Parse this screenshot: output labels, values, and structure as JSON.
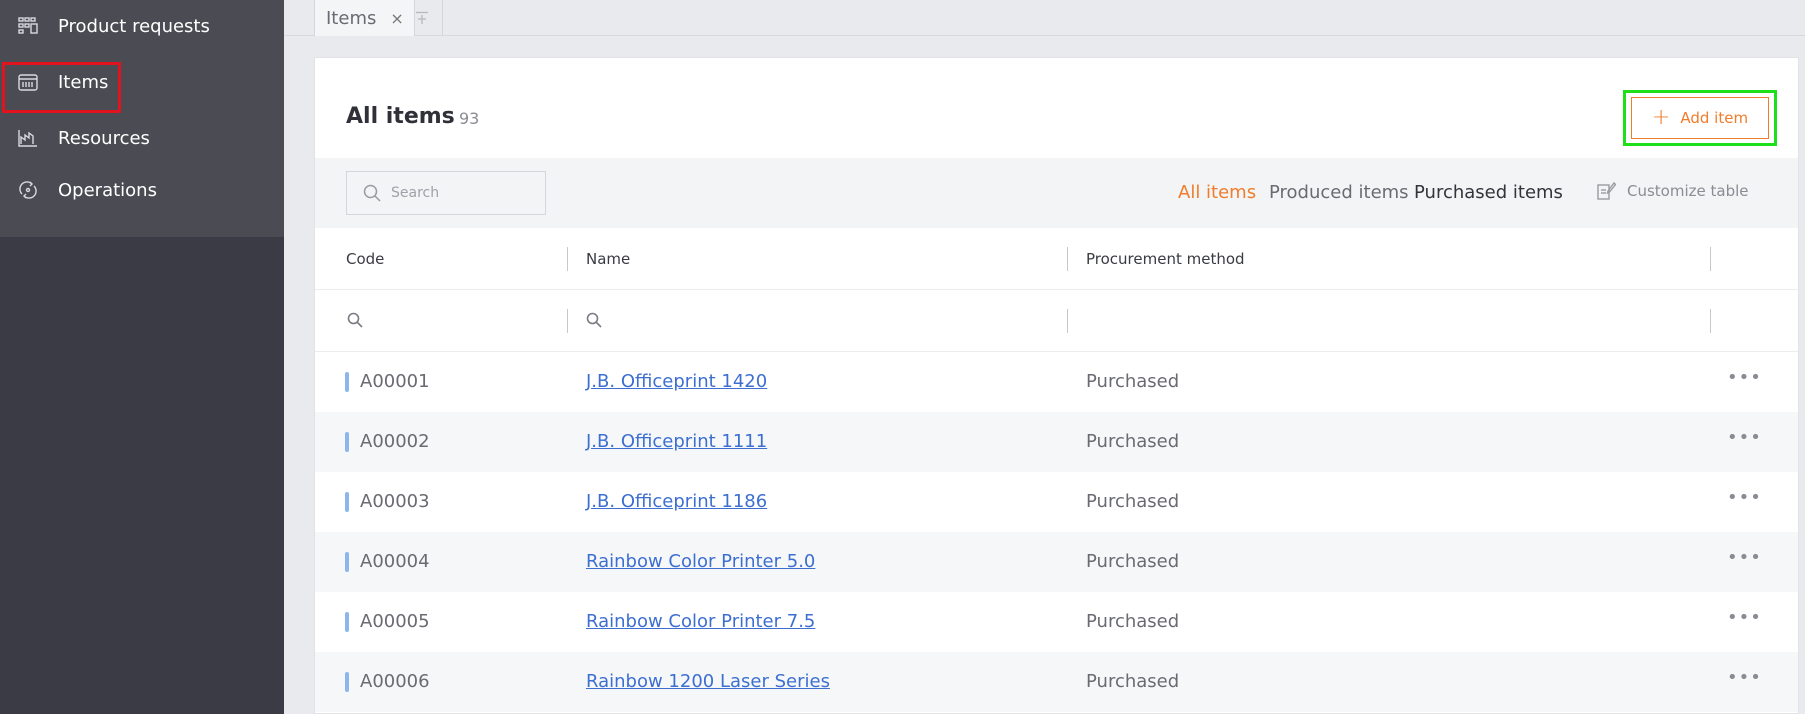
{
  "sidebar": {
    "items": [
      {
        "label": "Product requests",
        "icon": "product-requests-icon"
      },
      {
        "label": "Items",
        "icon": "items-icon"
      },
      {
        "label": "Resources",
        "icon": "resources-icon"
      },
      {
        "label": "Operations",
        "icon": "operations-icon"
      }
    ]
  },
  "tabs": {
    "active_label": "Items",
    "close_glyph": "×"
  },
  "header": {
    "title": "All items",
    "count": "93",
    "add_label": "Add item"
  },
  "toolbar": {
    "search_placeholder": "Search",
    "filters": {
      "all": "All items",
      "produced": "Produced items",
      "purchased": "Purchased items"
    },
    "customize_label": "Customize table"
  },
  "table": {
    "columns": {
      "code": "Code",
      "name": "Name",
      "procurement": "Procurement method"
    },
    "rows": [
      {
        "code": "A00001",
        "name": "J.B. Officeprint 1420",
        "method": "Purchased"
      },
      {
        "code": "A00002",
        "name": "J.B. Officeprint 1111",
        "method": "Purchased"
      },
      {
        "code": "A00003",
        "name": "J.B. Officeprint 1186",
        "method": "Purchased"
      },
      {
        "code": "A00004",
        "name": "Rainbow Color Printer 5.0",
        "method": "Purchased"
      },
      {
        "code": "A00005",
        "name": "Rainbow Color Printer 7.5",
        "method": "Purchased"
      },
      {
        "code": "A00006",
        "name": "Rainbow 1200 Laser Series",
        "method": "Purchased"
      }
    ],
    "more_glyph": "•••"
  },
  "colors": {
    "accent": "#f07c2c",
    "link": "#3d6fd1",
    "sidebar_bg": "#3a3b44",
    "sidebar_menu_bg": "#4a4b53",
    "highlight_red": "#e0141e",
    "highlight_green": "#1ee01a"
  }
}
